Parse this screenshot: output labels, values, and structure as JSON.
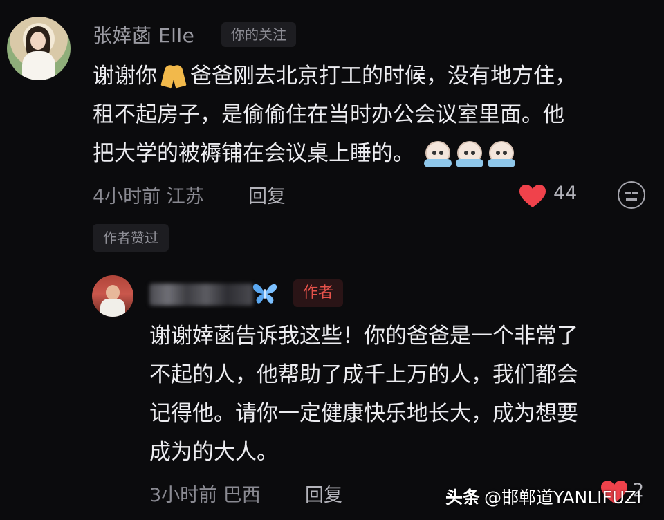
{
  "comment": {
    "username": "张婞菡 Elle",
    "follow_tag": "你的关注",
    "text_line1_a": "谢谢你",
    "text_line1_b": "爸爸刚去北京打工的时候，没有地方住，",
    "text_line2": "租不起房子，是偷偷住在当时办公会议室里面。他",
    "text_line3": "把大学的被褥铺在会议桌上睡的。",
    "time_location": "4小时前 江苏",
    "reply_label": "回复",
    "like_count": "44",
    "author_liked": "作者赞过",
    "icons": [
      "pray-icon",
      "crying-face-icon",
      "heart-icon",
      "dislike-face-icon"
    ]
  },
  "reply": {
    "author_tag": "作者",
    "text_line1": "谢谢婞菡告诉我这些！你的爸爸是一个非常了",
    "text_line2": "不起的人，他帮助了成千上万的人，我们都会",
    "text_line3": "记得他。请你一定健康快乐地长大，成为想要",
    "text_line4": "成为的大人。",
    "time_location": "3小时前 巴西",
    "reply_label": "回复",
    "like_count": "2",
    "icons": [
      "butterfly-icon",
      "heart-icon"
    ]
  },
  "watermark": {
    "brand": "头条",
    "handle": "@邯郸道YANLIFUZI"
  },
  "colors": {
    "background": "#0b0b0d",
    "text_primary": "#ececf0",
    "text_secondary": "#8a8a92",
    "like_red": "#f0424b",
    "author_tag_red": "#e6524b",
    "butterfly_blue": "#5aa7f0"
  }
}
